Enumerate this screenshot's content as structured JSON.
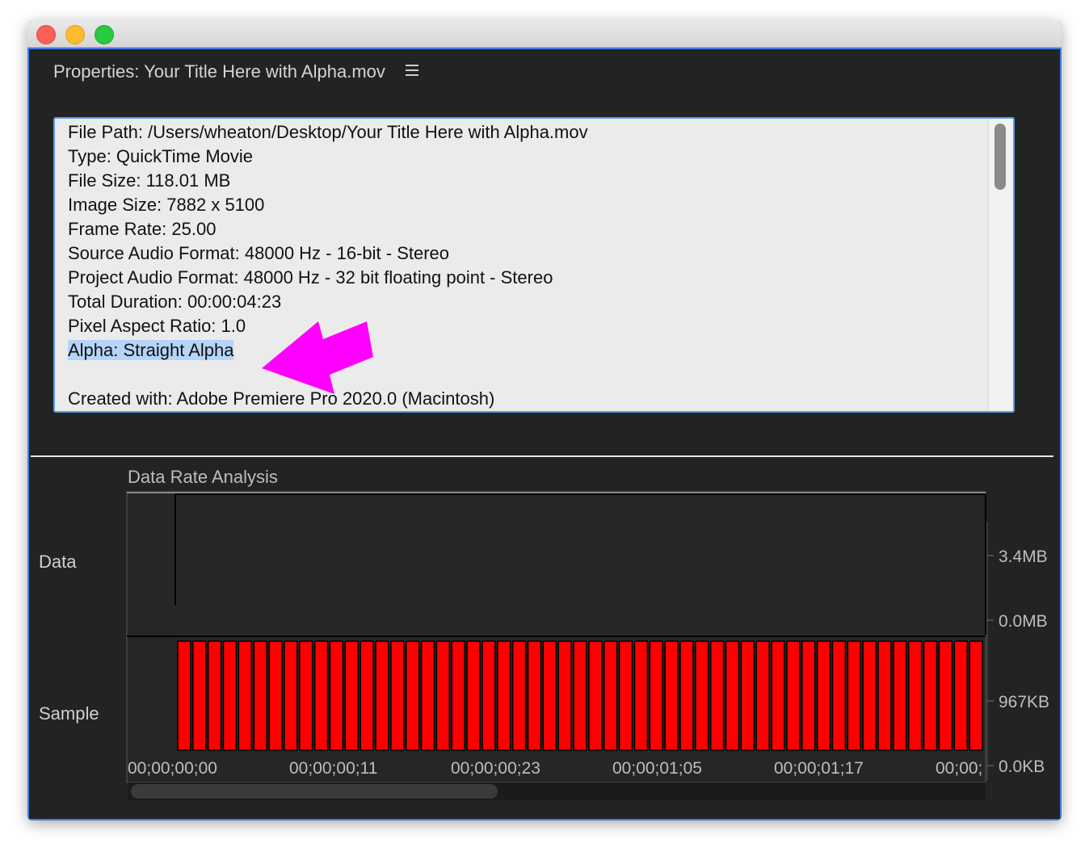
{
  "window": {
    "controls": [
      "close-icon",
      "minimize-icon",
      "zoom-icon"
    ]
  },
  "panel": {
    "title": "Properties: Your Title Here with Alpha.mov",
    "menu_icon": "hamburger-menu-icon"
  },
  "properties": [
    {
      "text": "File Path: /Users/wheaton/Desktop/Your Title Here with Alpha.mov"
    },
    {
      "text": "Type: QuickTime Movie"
    },
    {
      "text": "File Size: 118.01 MB"
    },
    {
      "text": "Image Size: 7882 x 5100"
    },
    {
      "text": "Frame Rate: 25.00"
    },
    {
      "text": "Source Audio Format: 48000 Hz - 16-bit - Stereo"
    },
    {
      "text": "Project Audio Format: 48000 Hz - 32 bit floating point - Stereo"
    },
    {
      "text": "Total Duration: 00:00:04:23"
    },
    {
      "text": "Pixel Aspect Ratio: 1.0"
    },
    {
      "text": "Alpha: Straight Alpha",
      "highlighted": true
    },
    {
      "text": ""
    },
    {
      "text": "Created with: Adobe Premiere Pro 2020.0 (Macintosh)"
    }
  ],
  "annotation": {
    "arrow_color": "#ff00ff",
    "icon": "magenta-arrow-icon"
  },
  "analysis": {
    "title": "Data Rate Analysis",
    "row_labels": {
      "data": "Data",
      "sample": "Sample"
    },
    "data_axis": [
      "3.4MB",
      "0.0MB"
    ],
    "sample_axis": [
      "967KB",
      "0.0KB"
    ],
    "timecodes": [
      "00;00;00;00",
      "00;00;00;11",
      "00;00;00;23",
      "00;00;01;05",
      "00;00;01;17",
      "00;00;"
    ],
    "bar_color": "#ff0000"
  },
  "chart_data": {
    "type": "bar",
    "title": "Data Rate Analysis",
    "series": [
      {
        "values": [
          967,
          967,
          967,
          967,
          967,
          967,
          967,
          967,
          967,
          967,
          967,
          967,
          967,
          967,
          967,
          967,
          967,
          967,
          967,
          967,
          967,
          967,
          967,
          967,
          967,
          967,
          967,
          967,
          967,
          967,
          967,
          967,
          967,
          967,
          967,
          967,
          967,
          967,
          967,
          967,
          967,
          967,
          967,
          967,
          967,
          967,
          967,
          967,
          967,
          967,
          967,
          967,
          967
        ]
      }
    ],
    "ylim": [
      0,
      967
    ],
    "grid": false
  }
}
